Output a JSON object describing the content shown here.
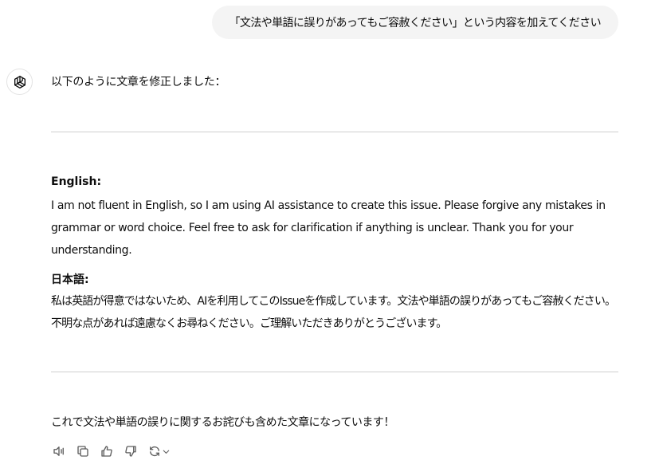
{
  "user_message": "「文法や単語に誤りがあってもご容赦ください」という内容を加えてください",
  "assistant": {
    "intro": "以下のように文章を修正しました：",
    "english_title": "English:",
    "english_body": "I am not fluent in English, so I am using AI assistance to create this issue. Please forgive any mistakes in grammar or word choice. Feel free to ask for clarification if anything is unclear. Thank you for your understanding.",
    "japanese_title": "日本語:",
    "japanese_body": "私は英語が得意ではないため、AIを利用してこのIssueを作成しています。文法や単語の誤りがあってもご容赦ください。不明な点があれば遠慮なくお尋ねください。ご理解いただきありがとうございます。",
    "outro": "これで文法や単語の誤りに関するお詫びも含めた文章になっています！"
  },
  "actions": [
    {
      "icon": "speaker-icon"
    },
    {
      "icon": "copy-icon"
    },
    {
      "icon": "thumbs-up-icon"
    },
    {
      "icon": "thumbs-down-icon"
    },
    {
      "icon": "regenerate-icon"
    }
  ]
}
